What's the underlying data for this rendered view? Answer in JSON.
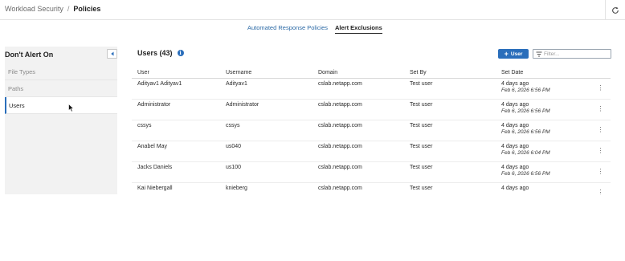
{
  "breadcrumb": {
    "parent": "Workload Security",
    "separator": "/",
    "current": "Policies"
  },
  "tabs": [
    {
      "label": "Automated Response Policies",
      "active": false
    },
    {
      "label": "Alert Exclusions",
      "active": true
    }
  ],
  "sidebar": {
    "title": "Don't Alert On",
    "items": [
      {
        "label": "File Types",
        "active": false
      },
      {
        "label": "Paths",
        "active": false
      },
      {
        "label": "Users",
        "active": true
      }
    ]
  },
  "main": {
    "title": "Users (43)",
    "add_button_label": "User",
    "filter_placeholder": "Filter...",
    "columns": [
      "User",
      "Username",
      "Domain",
      "Set By",
      "Set Date"
    ],
    "rows": [
      {
        "user": "Adityav1 Adityav1",
        "username": "Adityav1",
        "domain": "cslab.netapp.com",
        "set_by": "Test user",
        "set_date": "4 days ago",
        "set_date_full": "Feb 6, 2026 6:56 PM"
      },
      {
        "user": "Administrator",
        "username": "Administrator",
        "domain": "cslab.netapp.com",
        "set_by": "Test user",
        "set_date": "4 days ago",
        "set_date_full": "Feb 6, 2026 6:56 PM"
      },
      {
        "user": "cssys",
        "username": "cssys",
        "domain": "cslab.netapp.com",
        "set_by": "Test user",
        "set_date": "4 days ago",
        "set_date_full": "Feb 6, 2026 6:56 PM"
      },
      {
        "user": "Anabel May",
        "username": "us040",
        "domain": "cslab.netapp.com",
        "set_by": "Test user",
        "set_date": "4 days ago",
        "set_date_full": "Feb 6, 2026 6:04 PM"
      },
      {
        "user": "Jacks Daniels",
        "username": "us100",
        "domain": "cslab.netapp.com",
        "set_by": "Test user",
        "set_date": "4 days ago",
        "set_date_full": "Feb 6, 2026 6:56 PM"
      },
      {
        "user": "Kai Niebergall",
        "username": "knieberg",
        "domain": "cslab.netapp.com",
        "set_by": "Test user",
        "set_date": "4 days ago",
        "set_date_full": ""
      }
    ]
  },
  "colors": {
    "accent": "#2a6ebb",
    "link": "#2c6aa6",
    "panel_bg": "#f2f2f2"
  },
  "icons": {
    "refresh": "refresh-icon",
    "collapse": "chevron-left-icon",
    "info": "info-icon",
    "add": "plus-icon",
    "filter": "filter-icon",
    "row_menu": "kebab-menu-icon"
  }
}
